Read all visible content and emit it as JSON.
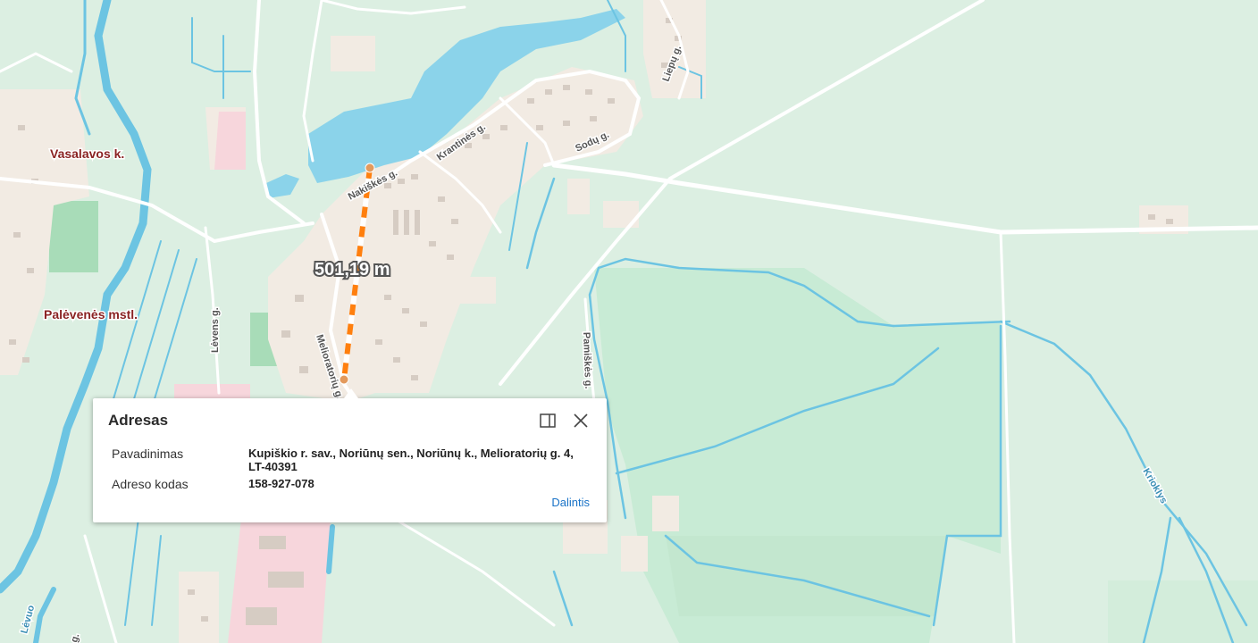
{
  "map": {
    "place_labels": [
      {
        "name": "Vasalavos k."
      },
      {
        "name": "Palėvenės mstl."
      }
    ],
    "street_labels": [
      {
        "name": "Liepų g."
      },
      {
        "name": "Krantinės g."
      },
      {
        "name": "Sodų g."
      },
      {
        "name": "Nakiškės g."
      },
      {
        "name": "Lėvens g."
      },
      {
        "name": "Melioratorių g."
      },
      {
        "name": "Pamiškės g."
      },
      {
        "name": "g."
      }
    ],
    "water_labels": [
      {
        "name": "Krioklys"
      },
      {
        "name": "Lėvuo"
      }
    ],
    "measurement": {
      "value": "501,19 m",
      "color": "#ff7f0e"
    },
    "colors": {
      "background": "#dcefe2",
      "forest": "#c8ebd5",
      "water": "#8bd3ea",
      "river": "#6cc4e2",
      "builtup": "#f2ebe3",
      "industrial": "#f7d6dc",
      "building": "#d6ccc3",
      "road": "#ffffff"
    }
  },
  "popup": {
    "title": "Adresas",
    "dock_icon": "dock-panel-icon",
    "close_icon": "close-icon",
    "rows": [
      {
        "label": "Pavadinimas",
        "value": "Kupiškio r. sav., Noriūnų sen., Noriūnų k., Melioratorių g. 4, LT-40391"
      },
      {
        "label": "Adreso kodas",
        "value": "158-927-078"
      }
    ],
    "share_label": "Dalintis"
  }
}
